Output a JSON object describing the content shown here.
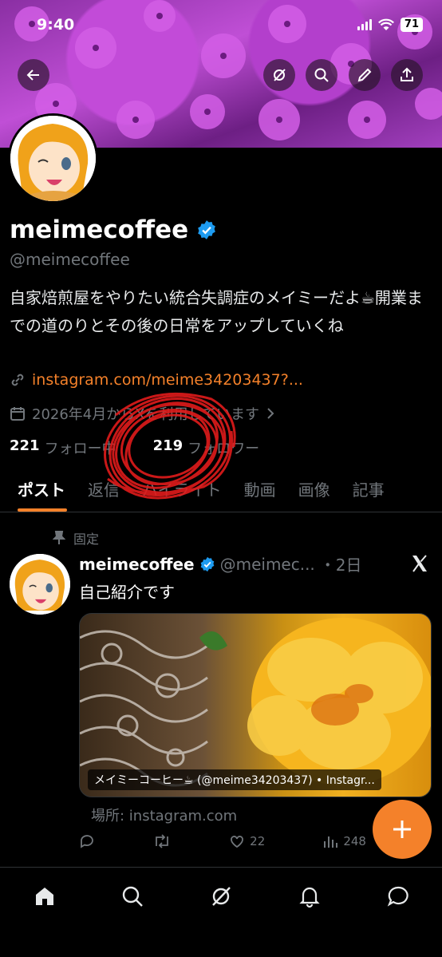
{
  "status_bar": {
    "time": "9:40",
    "battery": "71"
  },
  "profile": {
    "display_name": "meimecoffee",
    "handle": "@meimecoffee",
    "bio": "自家焙煎屋をやりたい統合失調症のメイミーだよ☕開業までの道のりとその後の日常をアップしていくね",
    "link": "instagram.com/meime34203437?...",
    "joined": "2026年4月からXを利用しています",
    "following_count": "221",
    "following_label": "フォロー中",
    "followers_count": "219",
    "followers_label": "フォロワー"
  },
  "tabs": [
    "ポスト",
    "返信",
    "ハイライト",
    "動画",
    "画像",
    "記事"
  ],
  "post": {
    "pinned_label": "固定",
    "author": "meimecoffee",
    "handle": "@meimec...",
    "time": "・2日",
    "text": "自己紹介です",
    "card_caption": "メイミーコーヒー☕ (@meime34203437) • Instagr...",
    "place": "場所: instagram.com",
    "likes": "22",
    "views": "248"
  },
  "colors": {
    "accent": "#f4812a",
    "verified": "#1d9bf0",
    "annotation": "#e01b1b"
  }
}
